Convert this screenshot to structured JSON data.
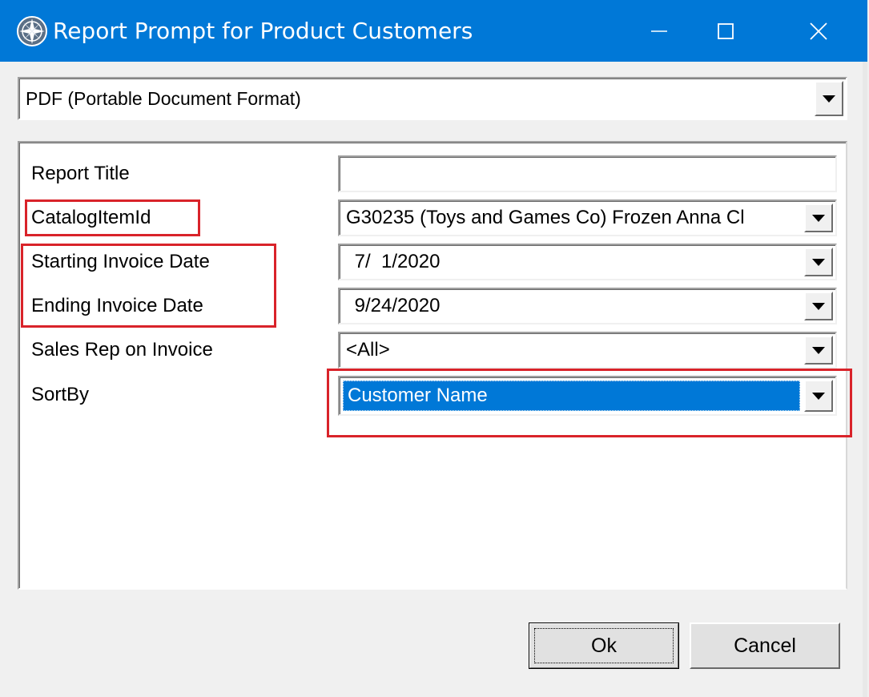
{
  "window": {
    "title": "Report Prompt for Product Customers",
    "icons": {
      "app": "compass-icon",
      "minimize": "minimize-icon",
      "maximize": "maximize-icon",
      "close": "close-icon"
    },
    "titlebar_color": "#0078d7"
  },
  "format_select": {
    "value": "PDF (Portable Document Format)"
  },
  "params": {
    "report_title": {
      "label": "Report Title",
      "value": ""
    },
    "catalog_item": {
      "label": "CatalogItemId",
      "value": "G30235 (Toys and Games Co) Frozen Anna Cl"
    },
    "start_date": {
      "label": "Starting Invoice Date",
      "value": " 7/  1/2020"
    },
    "end_date": {
      "label": "Ending Invoice Date",
      "value": " 9/24/2020"
    },
    "sales_rep": {
      "label": "Sales Rep on Invoice",
      "value": "<All>"
    },
    "sort_by": {
      "label": "SortBy",
      "value": "Customer Name"
    }
  },
  "buttons": {
    "ok": "Ok",
    "cancel": "Cancel"
  },
  "highlight_color": "#d9232a",
  "selection_color": "#0078d7"
}
